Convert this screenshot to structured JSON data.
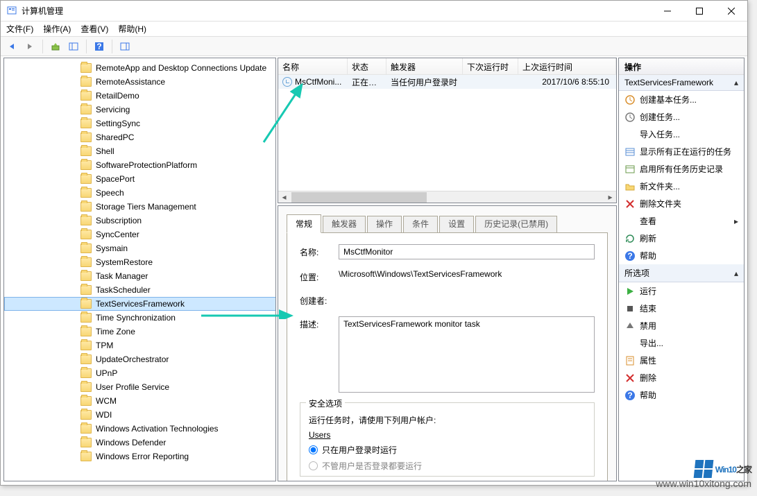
{
  "window": {
    "title": "计算机管理"
  },
  "menubar": [
    "文件(F)",
    "操作(A)",
    "查看(V)",
    "帮助(H)"
  ],
  "tree_items": [
    "RemoteApp and Desktop Connections Update",
    "RemoteAssistance",
    "RetailDemo",
    "Servicing",
    "SettingSync",
    "SharedPC",
    "Shell",
    "SoftwareProtectionPlatform",
    "SpacePort",
    "Speech",
    "Storage Tiers Management",
    "Subscription",
    "SyncCenter",
    "Sysmain",
    "SystemRestore",
    "Task Manager",
    "TaskScheduler",
    "TextServicesFramework",
    "Time Synchronization",
    "Time Zone",
    "TPM",
    "UpdateOrchestrator",
    "UPnP",
    "User Profile Service",
    "WCM",
    "WDI",
    "Windows Activation Technologies",
    "Windows Defender",
    "Windows Error Reporting"
  ],
  "tree_selected": "TextServicesFramework",
  "task_columns": {
    "name": "名称",
    "status": "状态",
    "trigger": "触发器",
    "next_run": "下次运行时间",
    "last_run": "上次运行时间"
  },
  "task_row": {
    "name": "MsCtfMoni...",
    "status": "正在运行",
    "trigger": "当任何用户登录时",
    "next_run": "",
    "last_run": "2017/10/6 8:55:10"
  },
  "tabs": [
    "常规",
    "触发器",
    "操作",
    "条件",
    "设置",
    "历史记录(已禁用)"
  ],
  "details": {
    "labels": {
      "name": "名称:",
      "location": "位置:",
      "author": "创建者:",
      "description": "描述:"
    },
    "name": "MsCtfMonitor",
    "location": "\\Microsoft\\Windows\\TextServicesFramework",
    "author": "",
    "description": "TextServicesFramework monitor task"
  },
  "security": {
    "legend": "安全选项",
    "prompt": "运行任务时，请使用下列用户帐户:",
    "account": "Users",
    "opt_logged_on": "只在用户登录时运行",
    "opt_not_logged_on": "不管用户是否登录都要运行"
  },
  "actions_pane": {
    "header": "操作",
    "group1_title": "TextServicesFramework",
    "group1_items": [
      {
        "id": "create-basic-task",
        "label": "创建基本任务...",
        "icon": "task-basic"
      },
      {
        "id": "create-task",
        "label": "创建任务...",
        "icon": "task"
      },
      {
        "id": "import-task",
        "label": "导入任务...",
        "icon": "blank"
      },
      {
        "id": "show-running",
        "label": "显示所有正在运行的任务",
        "icon": "list"
      },
      {
        "id": "enable-history",
        "label": "启用所有任务历史记录",
        "icon": "history"
      },
      {
        "id": "new-folder",
        "label": "新文件夹...",
        "icon": "folder"
      },
      {
        "id": "delete-folder",
        "label": "删除文件夹",
        "icon": "delete"
      },
      {
        "id": "view",
        "label": "查看",
        "icon": "blank",
        "sub": true
      },
      {
        "id": "refresh",
        "label": "刷新",
        "icon": "refresh"
      },
      {
        "id": "help",
        "label": "帮助",
        "icon": "help"
      }
    ],
    "group2_title": "所选项",
    "group2_items": [
      {
        "id": "run",
        "label": "运行",
        "icon": "run"
      },
      {
        "id": "end",
        "label": "结束",
        "icon": "end"
      },
      {
        "id": "disable",
        "label": "禁用",
        "icon": "disable"
      },
      {
        "id": "export",
        "label": "导出...",
        "icon": "blank"
      },
      {
        "id": "properties",
        "label": "属性",
        "icon": "props"
      },
      {
        "id": "delete",
        "label": "删除",
        "icon": "delete"
      },
      {
        "id": "help2",
        "label": "帮助",
        "icon": "help"
      }
    ]
  },
  "watermark": {
    "logo_text": "Win10",
    "logo_suffix": "之家",
    "url": "www.win10xitong.com"
  }
}
